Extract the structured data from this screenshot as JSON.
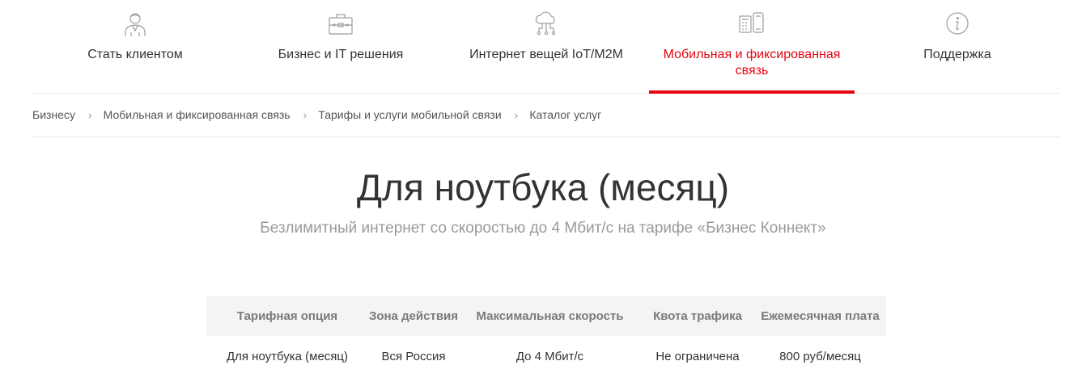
{
  "nav": {
    "items": [
      {
        "label": "Стать клиентом",
        "icon": "user-icon",
        "active": false
      },
      {
        "label": "Бизнес и IT решения",
        "icon": "briefcase-icon",
        "active": false
      },
      {
        "label": "Интернет вещей IoT/M2M",
        "icon": "cloud-network-icon",
        "active": false
      },
      {
        "label": "Мобильная и фиксированная связь",
        "icon": "phone-devices-icon",
        "active": true
      },
      {
        "label": "Поддержка",
        "icon": "info-icon",
        "active": false
      }
    ],
    "active_color": "#e30611"
  },
  "breadcrumb": {
    "items": [
      "Бизнесу",
      "Мобильная и фиксированная связь",
      "Тарифы и услуги мобильной связи",
      "Каталог услуг"
    ],
    "separator": "›"
  },
  "page": {
    "title": "Для ноутбука (месяц)",
    "subtitle": "Безлимитный интернет со скоростью до 4 Мбит/с на тарифе «Бизнес Коннект»"
  },
  "table": {
    "headers": [
      "Тарифная опция",
      "Зона действия",
      "Максимальная скорость",
      "Квота трафика",
      "Ежемесячная плата"
    ],
    "rows": [
      [
        "Для ноутбука (месяц)",
        "Вся Россия",
        "До 4 Мбит/с",
        "Не ограничена",
        "800 руб/месяц"
      ]
    ]
  }
}
